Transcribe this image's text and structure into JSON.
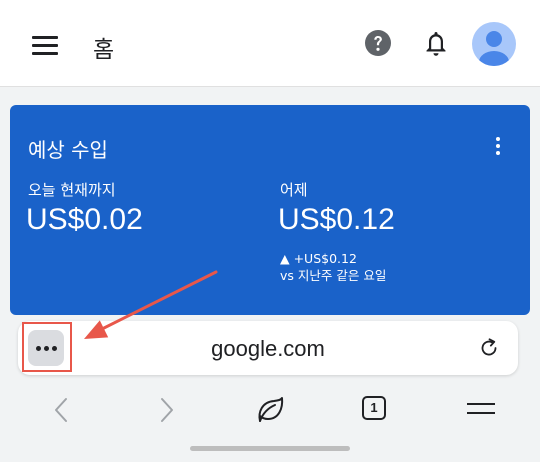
{
  "header": {
    "title": "홈",
    "icons": [
      "menu-icon",
      "help-icon",
      "notifications-icon",
      "account-avatar"
    ]
  },
  "card": {
    "title": "예상 수입",
    "today_label": "오늘 현재까지",
    "today_value": "US$0.02",
    "yesterday_label": "어제",
    "yesterday_value": "US$0.12",
    "change_value": "▲ +US$0.12",
    "change_note": "vs 지난주 같은 요일"
  },
  "browser": {
    "url": "google.com",
    "tab_count": "1"
  },
  "colors": {
    "card_bg": "#1a62c9",
    "annotation": "#e8574a",
    "avatar": "#4a86e8"
  }
}
